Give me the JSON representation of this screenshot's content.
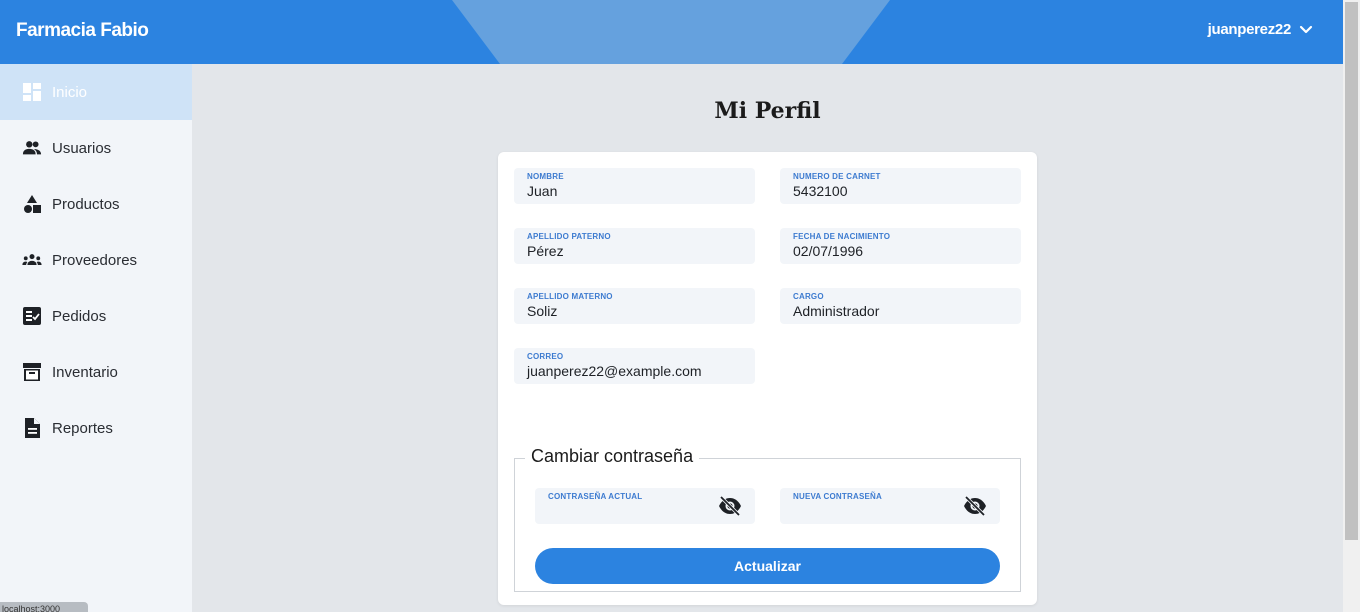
{
  "app": {
    "brand": "Farmacia Fabio"
  },
  "user": {
    "username": "juanperez22"
  },
  "sidebar": {
    "items": [
      {
        "label": "Inicio",
        "icon": "dashboard-icon",
        "active": true
      },
      {
        "label": "Usuarios",
        "icon": "users-icon"
      },
      {
        "label": "Productos",
        "icon": "shapes-icon"
      },
      {
        "label": "Proveedores",
        "icon": "group-icon"
      },
      {
        "label": "Pedidos",
        "icon": "checklist-icon"
      },
      {
        "label": "Inventario",
        "icon": "archive-icon"
      },
      {
        "label": "Reportes",
        "icon": "document-icon"
      }
    ]
  },
  "footer": {
    "version_text": "localhost:3000"
  },
  "profile": {
    "title": "Mi Perfil",
    "fields": {
      "nombre": {
        "label": "NOMBRE",
        "value": "Juan"
      },
      "carnet": {
        "label": "NUMERO DE CARNET",
        "value": "5432100"
      },
      "apellido_paterno": {
        "label": "APELLIDO PATERNO",
        "value": "Pérez"
      },
      "fecha_nacimiento": {
        "label": "FECHA DE NACIMIENTO",
        "value": "02/07/1996"
      },
      "apellido_materno": {
        "label": "APELLIDO MATERNO",
        "value": "Soliz"
      },
      "cargo": {
        "label": "CARGO",
        "value": "Administrador"
      },
      "correo": {
        "label": "CORREO",
        "value": "juanperez22@example.com"
      }
    },
    "password": {
      "legend": "Cambiar contraseña",
      "current_label": "CONTRASEÑA ACTUAL",
      "new_label": "NUEVA CONTRASEÑA",
      "submit_label": "Actualizar"
    }
  },
  "colors": {
    "primary": "#2c83e0",
    "sidebar_bg": "#f2f5f9",
    "sidebar_active": "#cfe3f7",
    "page_bg": "#e3e6ea",
    "label_blue": "#3d7bd0"
  }
}
